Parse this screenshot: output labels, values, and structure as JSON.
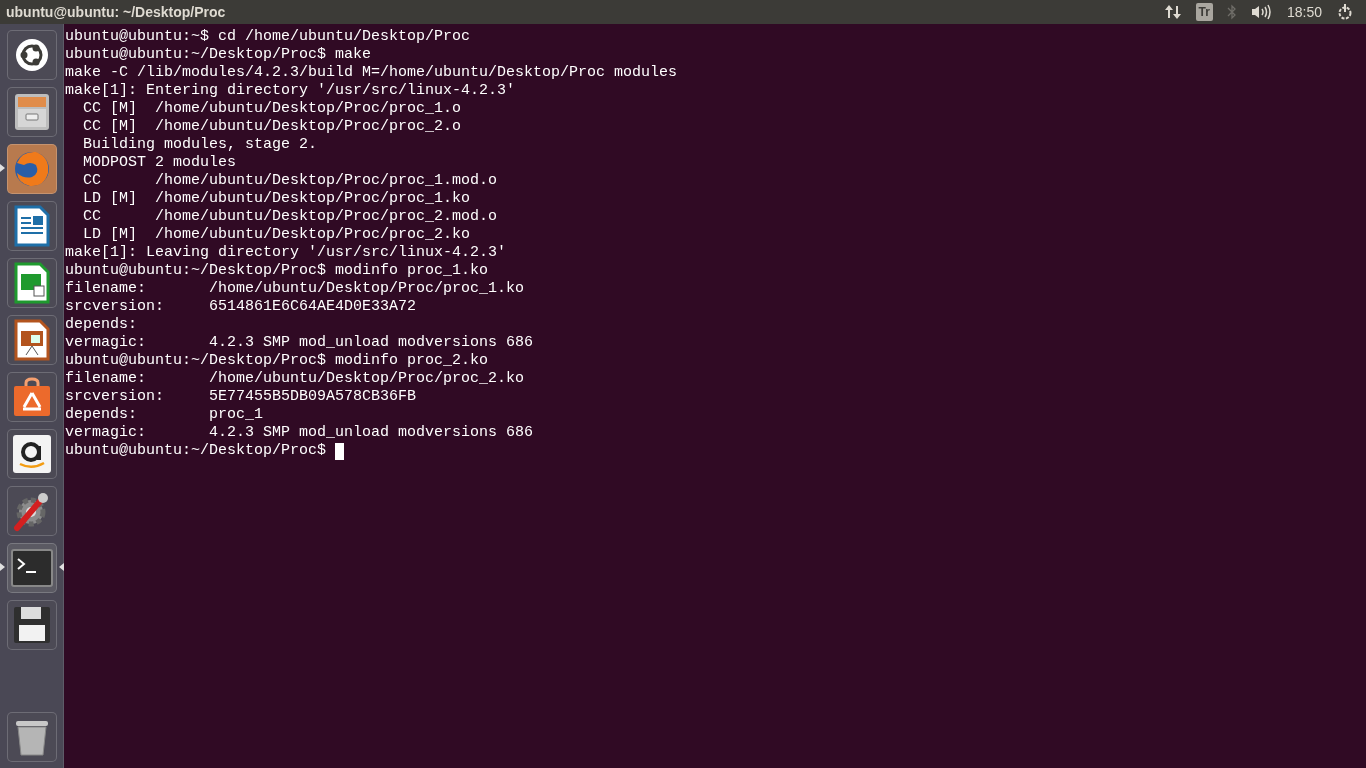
{
  "top_bar": {
    "title": "ubuntu@ubuntu: ~/Desktop/Proc",
    "indicators": [
      {
        "kind": "network"
      },
      {
        "kind": "keyboard",
        "label": "Tr"
      },
      {
        "kind": "bluetooth"
      },
      {
        "kind": "volume"
      },
      {
        "kind": "clock",
        "label": "18:50"
      },
      {
        "kind": "power"
      }
    ]
  },
  "launcher": {
    "items": [
      {
        "kind": "dash",
        "running": false,
        "focused": false
      },
      {
        "kind": "files",
        "running": false,
        "focused": false
      },
      {
        "kind": "browser",
        "running": true,
        "focused": false
      },
      {
        "kind": "writer",
        "running": false,
        "focused": false
      },
      {
        "kind": "calc",
        "running": false,
        "focused": false
      },
      {
        "kind": "impress",
        "running": false,
        "focused": false
      },
      {
        "kind": "software",
        "running": false,
        "focused": false
      },
      {
        "kind": "amazon",
        "running": false,
        "focused": false
      },
      {
        "kind": "settings",
        "running": false,
        "focused": false
      },
      {
        "kind": "terminal",
        "running": true,
        "focused": true
      },
      {
        "kind": "disk",
        "running": false,
        "focused": false
      }
    ],
    "trash": {
      "kind": "trash"
    }
  },
  "terminal": {
    "lines": [
      "ubuntu@ubuntu:~$ cd /home/ubuntu/Desktop/Proc",
      "ubuntu@ubuntu:~/Desktop/Proc$ make",
      "make -C /lib/modules/4.2.3/build M=/home/ubuntu/Desktop/Proc modules",
      "make[1]: Entering directory '/usr/src/linux-4.2.3'",
      "  CC [M]  /home/ubuntu/Desktop/Proc/proc_1.o",
      "  CC [M]  /home/ubuntu/Desktop/Proc/proc_2.o",
      "  Building modules, stage 2.",
      "  MODPOST 2 modules",
      "  CC      /home/ubuntu/Desktop/Proc/proc_1.mod.o",
      "  LD [M]  /home/ubuntu/Desktop/Proc/proc_1.ko",
      "  CC      /home/ubuntu/Desktop/Proc/proc_2.mod.o",
      "  LD [M]  /home/ubuntu/Desktop/Proc/proc_2.ko",
      "make[1]: Leaving directory '/usr/src/linux-4.2.3'",
      "ubuntu@ubuntu:~/Desktop/Proc$ modinfo proc_1.ko",
      "filename:       /home/ubuntu/Desktop/Proc/proc_1.ko",
      "srcversion:     6514861E6C64AE4D0E33A72",
      "depends:        ",
      "vermagic:       4.2.3 SMP mod_unload modversions 686",
      "ubuntu@ubuntu:~/Desktop/Proc$ modinfo proc_2.ko",
      "filename:       /home/ubuntu/Desktop/Proc/proc_2.ko",
      "srcversion:     5E77455B5DB09A578CB36FB",
      "depends:        proc_1",
      "vermagic:       4.2.3 SMP mod_unload modversions 686"
    ],
    "prompt": "ubuntu@ubuntu:~/Desktop/Proc$ "
  }
}
